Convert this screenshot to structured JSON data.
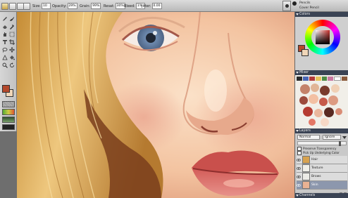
{
  "property_bar": {
    "size_label": "Size:",
    "size_value": "10",
    "opacity_label": "Opacity:",
    "opacity_value": "29%",
    "grain_label": "Grain:",
    "grain_value": "99%",
    "resat_label": "Resat:",
    "resat_value": "30%",
    "bleed_label": "Bleed:",
    "bleed_value": "1%",
    "jitter_label": "Jitter:",
    "jitter_value": "0.00",
    "brush_category": "Pencils",
    "brush_variant": "Cover Pencil"
  },
  "colors_panel": {
    "title": "Colors"
  },
  "mixer_panel": {
    "title": "Mixer"
  },
  "layers_panel": {
    "title": "Layers",
    "composite_method": "Normal",
    "composite_depth": "Ignore",
    "preserve_transparency": "Preserve Transparency",
    "pick_up_color": "Pick Up Underlying Color",
    "layers": [
      {
        "name": "Hair",
        "active": false
      },
      {
        "name": "Texture",
        "active": false
      },
      {
        "name": "Brows",
        "active": false
      },
      {
        "name": "Skin",
        "active": true
      }
    ]
  },
  "channels_panel": {
    "title": "Channels"
  },
  "colors": {
    "panel_title_bar": "#3a4354",
    "skin": "#f2c3a0",
    "hair": "#d9a64f",
    "lips": "#d86d6b",
    "iris": "#6f8bb0",
    "main_color": "#b4492c",
    "secondary_color": "#f0d6b8"
  },
  "icons": [
    "pencil-icon",
    "brush-icon",
    "eraser-icon",
    "selection-icon",
    "lasso-icon",
    "crop-icon",
    "move-icon",
    "text-icon",
    "shape-icon",
    "dropper-icon",
    "bucket-icon",
    "grabber-icon",
    "magnifier-icon",
    "rotate-icon",
    "eye-icon",
    "new-layer-icon",
    "delete-layer-icon"
  ]
}
